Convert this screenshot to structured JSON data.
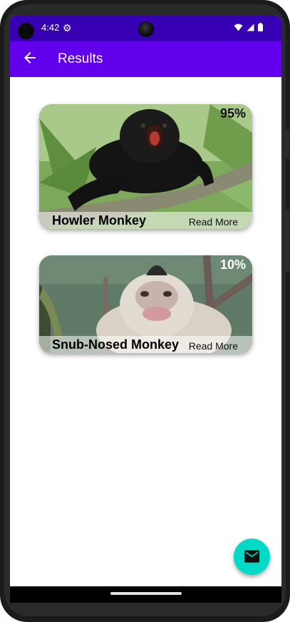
{
  "status_bar": {
    "time": "4:42",
    "icons": [
      "settings-gear-icon",
      "wifi-icon",
      "signal-icon",
      "battery-icon"
    ],
    "background": "#3700b3"
  },
  "app_bar": {
    "title": "Results",
    "back_icon": "arrow-back-icon",
    "background": "#6200ee"
  },
  "results": [
    {
      "name": "Howler Monkey",
      "confidence": "95%",
      "link": "Read More",
      "image": "howler-monkey-photo"
    },
    {
      "name": "Snub-Nosed Monkey",
      "confidence": "10%",
      "link": "Read More",
      "image": "snub-nosed-monkey-photo"
    }
  ],
  "fab": {
    "icon": "email-icon",
    "color": "#03dac5"
  }
}
